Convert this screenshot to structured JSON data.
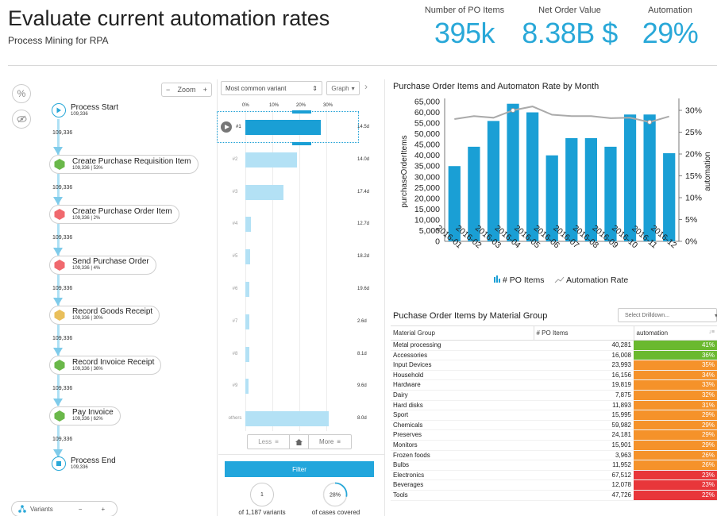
{
  "header": {
    "title": "Evaluate current automation rates",
    "subtitle": "Process Mining for RPA",
    "kpis": [
      {
        "label": "Number of PO Items",
        "value": "395k"
      },
      {
        "label": "Net Order Value",
        "value": "8.38B $"
      },
      {
        "label": "Automation",
        "value": "29%"
      }
    ]
  },
  "toolbar": {
    "percent_glyph": "%",
    "zoom_minus": "−",
    "zoom_label": "Zoom",
    "zoom_plus": "+"
  },
  "process_map": {
    "start": {
      "name": "Process Start",
      "count": "109,336"
    },
    "steps": [
      {
        "name": "Create Purchase Requisition Item",
        "stats": "109,336 | 53%",
        "color": "#6ab84a",
        "edge": "109,336"
      },
      {
        "name": "Create Purchase Order Item",
        "stats": "109,336 | 2%",
        "color": "#f0696e",
        "edge": "109,336"
      },
      {
        "name": "Send Purchase Order",
        "stats": "109,336 | 4%",
        "color": "#f0696e",
        "edge": "109,336"
      },
      {
        "name": "Record Goods Receipt",
        "stats": "109,336 | 30%",
        "color": "#e9bf5b",
        "edge": "109,336"
      },
      {
        "name": "Record Invoice Receipt",
        "stats": "109,336 | 36%",
        "color": "#6ab84a",
        "edge": "109,336"
      },
      {
        "name": "Pay Invoice",
        "stats": "109,336 | 62%",
        "color": "#6ab84a",
        "edge": "109,336"
      }
    ],
    "final_edge": "109,336",
    "end": {
      "name": "Process End",
      "count": "109,336"
    }
  },
  "variants_control": {
    "label": "Variants",
    "minus": "−",
    "plus": "+"
  },
  "variants_panel": {
    "select_value": "Most common variant",
    "graph_label": "Graph",
    "next_glyph": "›",
    "axis_ticks": [
      "0%",
      "10%",
      "20%",
      "30%"
    ],
    "axis_max": 40,
    "rows": [
      {
        "label": "#1",
        "share": 28,
        "duration": "14.5d",
        "selected": true
      },
      {
        "label": "#2",
        "share": 19,
        "duration": "14.0d"
      },
      {
        "label": "#3",
        "share": 14,
        "duration": "17.4d"
      },
      {
        "label": "#4",
        "share": 2,
        "duration": "12.7d"
      },
      {
        "label": "#5",
        "share": 1.8,
        "duration": "18.2d"
      },
      {
        "label": "#6",
        "share": 1.6,
        "duration": "19.6d"
      },
      {
        "label": "#7",
        "share": 1.5,
        "duration": "2.6d"
      },
      {
        "label": "#8",
        "share": 1.4,
        "duration": "8.1d"
      },
      {
        "label": "#9",
        "share": 1.2,
        "duration": "9.6d"
      },
      {
        "label": "others",
        "share": 31,
        "duration": "8.0d"
      }
    ],
    "less_label": "Less",
    "more_label": "More",
    "filter_label": "Filter",
    "variant_count_value": "1",
    "variant_count_label": "of 1,187 variants",
    "coverage_value": "28%",
    "coverage_fraction": 0.28,
    "coverage_label": "of cases covered"
  },
  "monthly_chart": {
    "title": "Purchase Order Items and Automaton Rate by Month",
    "legend_bar": "# PO Items",
    "legend_line": "Automation Rate"
  },
  "chart_data": {
    "type": "bar",
    "title": "Purchase Order Items and Automaton Rate by Month",
    "categories": [
      "2016-01",
      "2016-02",
      "2016-03",
      "2016-04",
      "2016-05",
      "2016-06",
      "2016-07",
      "2016-08",
      "2016-09",
      "2016-10",
      "2016-11",
      "2016-12"
    ],
    "series": [
      {
        "name": "# PO Items",
        "type": "bar",
        "axis": "left",
        "color": "#1a9fd5",
        "values": [
          35000,
          44000,
          56000,
          64000,
          60000,
          40000,
          48000,
          48000,
          44000,
          59000,
          59000,
          41000
        ]
      },
      {
        "name": "Automation Rate",
        "type": "line",
        "axis": "right",
        "color": "#aaaaaa",
        "values": [
          28,
          28.7,
          28.3,
          30,
          30.9,
          29,
          28.7,
          28.7,
          28.2,
          28.3,
          27.3,
          28.6
        ]
      }
    ],
    "ylabel": "purchaseOrderItems",
    "ylim": [
      0,
      65000
    ],
    "yticks": [
      "0",
      "5,000",
      "10,000",
      "15,000",
      "20,000",
      "25,000",
      "30,000",
      "35,000",
      "40,000",
      "45,000",
      "50,000",
      "55,000",
      "60,000",
      "65,000"
    ],
    "y2label": "automation",
    "y2lim": [
      0,
      32
    ],
    "y2ticks": [
      "0%",
      "5%",
      "10%",
      "15%",
      "20%",
      "25%",
      "30%"
    ],
    "legend_position": "bottom"
  },
  "material_table": {
    "title": "Puchase Order Items by Material Group",
    "drilldown_placeholder": "Select Drilldown...",
    "columns": [
      "Material Group",
      "# PO Items",
      "automation"
    ],
    "sort_glyph": "↓≡",
    "rows": [
      {
        "group": "Metal processing",
        "items": "40,281",
        "automation": "41%",
        "color": "#6ab92f"
      },
      {
        "group": "Accessories",
        "items": "16,008",
        "automation": "36%",
        "color": "#6ab92f"
      },
      {
        "group": "Input Devices",
        "items": "23,993",
        "automation": "35%",
        "color": "#f5922a"
      },
      {
        "group": "Household",
        "items": "16,156",
        "automation": "34%",
        "color": "#f5922a"
      },
      {
        "group": "Hardware",
        "items": "19,819",
        "automation": "33%",
        "color": "#f5922a"
      },
      {
        "group": "Dairy",
        "items": "7,875",
        "automation": "32%",
        "color": "#f5922a"
      },
      {
        "group": "Hard disks",
        "items": "11,893",
        "automation": "31%",
        "color": "#f5922a"
      },
      {
        "group": "Sport",
        "items": "15,995",
        "automation": "29%",
        "color": "#f5922a"
      },
      {
        "group": "Chemicals",
        "items": "59,982",
        "automation": "29%",
        "color": "#f5922a"
      },
      {
        "group": "Preserves",
        "items": "24,181",
        "automation": "29%",
        "color": "#f5922a"
      },
      {
        "group": "Monitors",
        "items": "15,901",
        "automation": "29%",
        "color": "#f5922a"
      },
      {
        "group": "Frozen foods",
        "items": "3,963",
        "automation": "26%",
        "color": "#f5922a"
      },
      {
        "group": "Bulbs",
        "items": "11,952",
        "automation": "26%",
        "color": "#f5922a"
      },
      {
        "group": "Electronics",
        "items": "67,512",
        "automation": "23%",
        "color": "#e8363a"
      },
      {
        "group": "Beverages",
        "items": "12,078",
        "automation": "23%",
        "color": "#e8363a"
      },
      {
        "group": "Tools",
        "items": "47,726",
        "automation": "22%",
        "color": "#e8363a"
      }
    ]
  }
}
